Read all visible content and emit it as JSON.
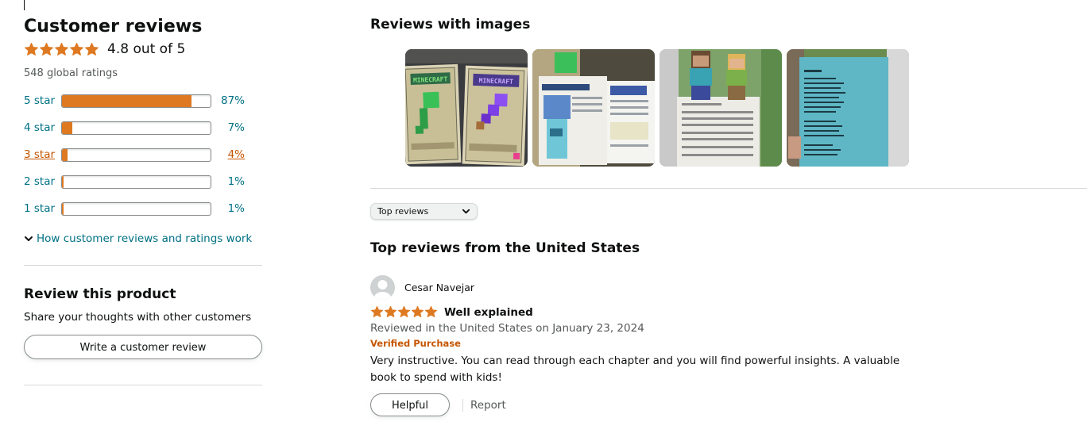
{
  "summary": {
    "heading": "Customer reviews",
    "average_rating": 4.8,
    "rating_text": "4.8 out of 5",
    "global_ratings": "548 global ratings",
    "star_color": "#de7921"
  },
  "histogram": [
    {
      "label": "5 star",
      "percent_text": "87%",
      "fraction": 0.87,
      "highlighted": false
    },
    {
      "label": "4 star",
      "percent_text": "7%",
      "fraction": 0.07,
      "highlighted": false
    },
    {
      "label": "3 star",
      "percent_text": "4%",
      "fraction": 0.04,
      "highlighted": true
    },
    {
      "label": "2 star",
      "percent_text": "1%",
      "fraction": 0.01,
      "highlighted": false
    },
    {
      "label": "1 star",
      "percent_text": "1%",
      "fraction": 0.01,
      "highlighted": false
    }
  ],
  "how_reviews_work": "How customer reviews and ratings work",
  "review_product": {
    "heading": "Review this product",
    "subtext": "Share your thoughts with other customers",
    "button_label": "Write a customer review"
  },
  "images_section": {
    "heading": "Reviews with images",
    "thumbnails": [
      {
        "subject": "book-covers-photo",
        "cover_texts": [
          "MINECRAFT",
          "MINECRAFT"
        ]
      },
      {
        "subject": "book-open-page-photo",
        "cover_texts": []
      },
      {
        "subject": "figurines-on-page-photo",
        "cover_texts": []
      },
      {
        "subject": "contents-page-photo",
        "cover_texts": []
      }
    ]
  },
  "sort": {
    "selected": "Top reviews"
  },
  "top_reviews": {
    "heading": "Top reviews from the United States",
    "reviews": [
      {
        "reviewer": "Cesar Navejar",
        "rating": 5,
        "title": "Well explained",
        "date": "Reviewed in the United States on January 23, 2024",
        "badge": "Verified Purchase",
        "body": "Very instructive. You can read through each chapter and you will find powerful insights. A valuable book to spend with kids!",
        "helpful_label": "Helpful",
        "report_label": "Report"
      }
    ]
  }
}
